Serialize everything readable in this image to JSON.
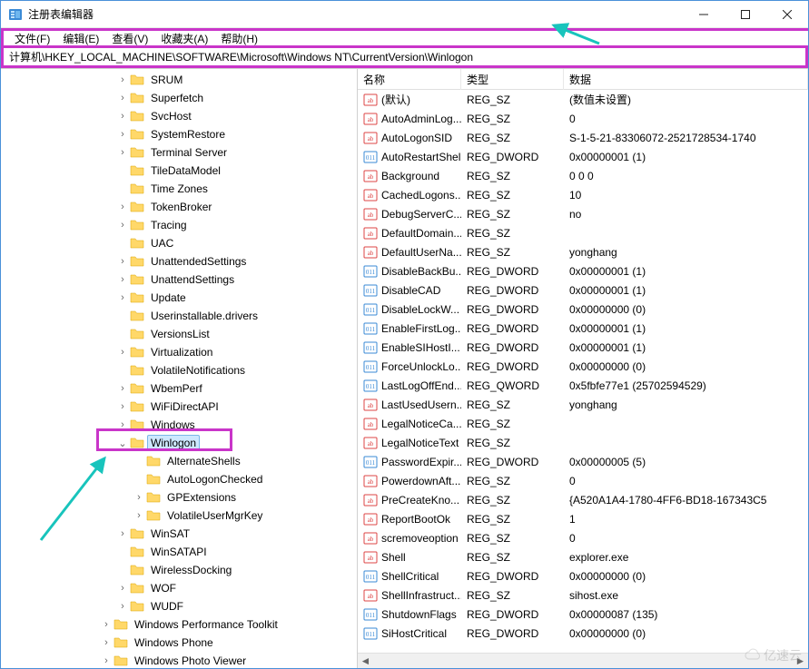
{
  "window": {
    "title": "注册表编辑器"
  },
  "menu": {
    "file": "文件(F)",
    "edit": "编辑(E)",
    "view": "查看(V)",
    "favorites": "收藏夹(A)",
    "help": "帮助(H)"
  },
  "address": "计算机\\HKEY_LOCAL_MACHINE\\SOFTWARE\\Microsoft\\Windows NT\\CurrentVersion\\Winlogon",
  "columns": {
    "name": "名称",
    "type": "类型",
    "data": "数据"
  },
  "tree": [
    {
      "depth": 7,
      "exp": ">",
      "label": "SRUM"
    },
    {
      "depth": 7,
      "exp": ">",
      "label": "Superfetch"
    },
    {
      "depth": 7,
      "exp": ">",
      "label": "SvcHost"
    },
    {
      "depth": 7,
      "exp": ">",
      "label": "SystemRestore"
    },
    {
      "depth": 7,
      "exp": ">",
      "label": "Terminal Server"
    },
    {
      "depth": 7,
      "exp": "",
      "label": "TileDataModel"
    },
    {
      "depth": 7,
      "exp": "",
      "label": "Time Zones"
    },
    {
      "depth": 7,
      "exp": ">",
      "label": "TokenBroker"
    },
    {
      "depth": 7,
      "exp": ">",
      "label": "Tracing"
    },
    {
      "depth": 7,
      "exp": "",
      "label": "UAC"
    },
    {
      "depth": 7,
      "exp": ">",
      "label": "UnattendedSettings"
    },
    {
      "depth": 7,
      "exp": ">",
      "label": "UnattendSettings"
    },
    {
      "depth": 7,
      "exp": ">",
      "label": "Update"
    },
    {
      "depth": 7,
      "exp": "",
      "label": "Userinstallable.drivers"
    },
    {
      "depth": 7,
      "exp": "",
      "label": "VersionsList"
    },
    {
      "depth": 7,
      "exp": ">",
      "label": "Virtualization"
    },
    {
      "depth": 7,
      "exp": "",
      "label": "VolatileNotifications"
    },
    {
      "depth": 7,
      "exp": ">",
      "label": "WbemPerf"
    },
    {
      "depth": 7,
      "exp": ">",
      "label": "WiFiDirectAPI"
    },
    {
      "depth": 7,
      "exp": ">",
      "label": "Windows"
    },
    {
      "depth": 7,
      "exp": "v",
      "label": "Winlogon",
      "selected": true
    },
    {
      "depth": 8,
      "exp": "",
      "label": "AlternateShells"
    },
    {
      "depth": 8,
      "exp": "",
      "label": "AutoLogonChecked"
    },
    {
      "depth": 8,
      "exp": ">",
      "label": "GPExtensions"
    },
    {
      "depth": 8,
      "exp": ">",
      "label": "VolatileUserMgrKey"
    },
    {
      "depth": 7,
      "exp": ">",
      "label": "WinSAT"
    },
    {
      "depth": 7,
      "exp": "",
      "label": "WinSATAPI"
    },
    {
      "depth": 7,
      "exp": "",
      "label": "WirelessDocking"
    },
    {
      "depth": 7,
      "exp": ">",
      "label": "WOF"
    },
    {
      "depth": 7,
      "exp": ">",
      "label": "WUDF"
    },
    {
      "depth": 6,
      "exp": ">",
      "label": "Windows Performance Toolkit"
    },
    {
      "depth": 6,
      "exp": ">",
      "label": "Windows Phone"
    },
    {
      "depth": 6,
      "exp": ">",
      "label": "Windows Photo Viewer"
    }
  ],
  "values": [
    {
      "icon": "sz",
      "name": "(默认)",
      "type": "REG_SZ",
      "data": "(数值未设置)"
    },
    {
      "icon": "sz",
      "name": "AutoAdminLog...",
      "type": "REG_SZ",
      "data": "0"
    },
    {
      "icon": "sz",
      "name": "AutoLogonSID",
      "type": "REG_SZ",
      "data": "S-1-5-21-83306072-2521728534-1740"
    },
    {
      "icon": "dw",
      "name": "AutoRestartShell",
      "type": "REG_DWORD",
      "data": "0x00000001 (1)"
    },
    {
      "icon": "sz",
      "name": "Background",
      "type": "REG_SZ",
      "data": "0 0 0"
    },
    {
      "icon": "sz",
      "name": "CachedLogons...",
      "type": "REG_SZ",
      "data": "10"
    },
    {
      "icon": "sz",
      "name": "DebugServerC...",
      "type": "REG_SZ",
      "data": "no"
    },
    {
      "icon": "sz",
      "name": "DefaultDomain...",
      "type": "REG_SZ",
      "data": ""
    },
    {
      "icon": "sz",
      "name": "DefaultUserNa...",
      "type": "REG_SZ",
      "data": "yonghang"
    },
    {
      "icon": "dw",
      "name": "DisableBackBu...",
      "type": "REG_DWORD",
      "data": "0x00000001 (1)"
    },
    {
      "icon": "dw",
      "name": "DisableCAD",
      "type": "REG_DWORD",
      "data": "0x00000001 (1)"
    },
    {
      "icon": "dw",
      "name": "DisableLockW...",
      "type": "REG_DWORD",
      "data": "0x00000000 (0)"
    },
    {
      "icon": "dw",
      "name": "EnableFirstLog...",
      "type": "REG_DWORD",
      "data": "0x00000001 (1)"
    },
    {
      "icon": "dw",
      "name": "EnableSIHostI...",
      "type": "REG_DWORD",
      "data": "0x00000001 (1)"
    },
    {
      "icon": "dw",
      "name": "ForceUnlockLo...",
      "type": "REG_DWORD",
      "data": "0x00000000 (0)"
    },
    {
      "icon": "dw",
      "name": "LastLogOffEnd...",
      "type": "REG_QWORD",
      "data": "0x5fbfe77e1 (25702594529)"
    },
    {
      "icon": "sz",
      "name": "LastUsedUsern...",
      "type": "REG_SZ",
      "data": "yonghang"
    },
    {
      "icon": "sz",
      "name": "LegalNoticeCa...",
      "type": "REG_SZ",
      "data": ""
    },
    {
      "icon": "sz",
      "name": "LegalNoticeText",
      "type": "REG_SZ",
      "data": ""
    },
    {
      "icon": "dw",
      "name": "PasswordExpir...",
      "type": "REG_DWORD",
      "data": "0x00000005 (5)"
    },
    {
      "icon": "sz",
      "name": "PowerdownAft...",
      "type": "REG_SZ",
      "data": "0"
    },
    {
      "icon": "sz",
      "name": "PreCreateKno...",
      "type": "REG_SZ",
      "data": "{A520A1A4-1780-4FF6-BD18-167343C5"
    },
    {
      "icon": "sz",
      "name": "ReportBootOk",
      "type": "REG_SZ",
      "data": "1"
    },
    {
      "icon": "sz",
      "name": "scremoveoption",
      "type": "REG_SZ",
      "data": "0"
    },
    {
      "icon": "sz",
      "name": "Shell",
      "type": "REG_SZ",
      "data": "explorer.exe"
    },
    {
      "icon": "dw",
      "name": "ShellCritical",
      "type": "REG_DWORD",
      "data": "0x00000000 (0)"
    },
    {
      "icon": "sz",
      "name": "ShellInfrastruct...",
      "type": "REG_SZ",
      "data": "sihost.exe"
    },
    {
      "icon": "dw",
      "name": "ShutdownFlags",
      "type": "REG_DWORD",
      "data": "0x00000087 (135)"
    },
    {
      "icon": "dw",
      "name": "SiHostCritical",
      "type": "REG_DWORD",
      "data": "0x00000000 (0)"
    }
  ],
  "watermark": "亿速云"
}
